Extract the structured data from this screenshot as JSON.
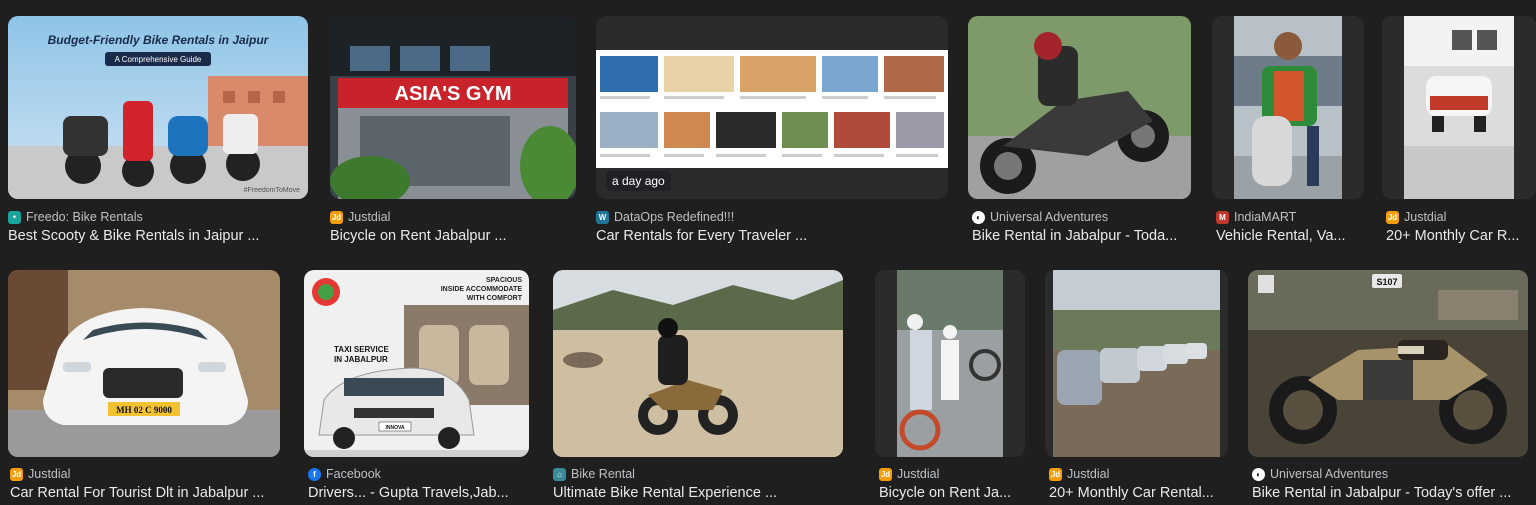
{
  "results": [
    {
      "source": "Freedo: Bike Rentals",
      "source_icon": "freedo-favicon",
      "title": "Best Scooty & Bike Rentals in Jaipur ...",
      "image_text": {
        "headline": "Budget-Friendly Bike Rentals in Jaipur",
        "subhead": "A Comprehensive Guide",
        "tag": "#FreedomToMove"
      }
    },
    {
      "source": "Justdial",
      "source_icon": "justdial-favicon",
      "title": "Bicycle on Rent Jabalpur ...",
      "image_text": {
        "sign": "ASIA'S GYM"
      }
    },
    {
      "source": "DataOps Redefined!!!",
      "source_icon": "wordpress-favicon",
      "title": "Car Rentals for Every Traveler ...",
      "badge": "a day ago"
    },
    {
      "source": "Universal Adventures",
      "source_icon": "universal-adventures-favicon",
      "title": "Bike Rental in Jabalpur - Toda..."
    },
    {
      "source": "IndiaMART",
      "source_icon": "indiamart-favicon",
      "title": "Vehicle Rental, Va..."
    },
    {
      "source": "Justdial",
      "source_icon": "justdial-favicon",
      "title": "20+ Monthly Car R..."
    },
    {
      "source": "Justdial",
      "source_icon": "justdial-favicon",
      "title": "Car Rental For Tourist Dlt in Jabalpur ...",
      "image_text": {
        "plate": "MH 02 C 9000"
      }
    },
    {
      "source": "Facebook",
      "source_icon": "facebook-favicon",
      "title": "Drivers... - Gupta Travels,Jab...",
      "image_text": {
        "line1": "SPACIOUS",
        "line2": "INSIDE ACCOMMODATE",
        "line3": "WITH COMFORT",
        "service1": "TAXI SERVICE",
        "service2": "IN JABALPUR",
        "plate": "INNOVA"
      }
    },
    {
      "source": "Bike Rental",
      "source_icon": "bike-rental-favicon",
      "title": "Ultimate Bike Rental Experience ..."
    },
    {
      "source": "Justdial",
      "source_icon": "justdial-favicon",
      "title": "Bicycle on Rent Ja..."
    },
    {
      "source": "Justdial",
      "source_icon": "justdial-favicon",
      "title": "20+ Monthly Car Rental..."
    },
    {
      "source": "Universal Adventures",
      "source_icon": "universal-adventures-favicon",
      "title": "Bike Rental in Jabalpur - Today's offer ...",
      "image_text": {
        "sign": "S107"
      }
    }
  ],
  "colors": {
    "background": "#1f1f1f",
    "source_text": "#bdc1c6",
    "title_text": "#e8eaed",
    "justdial": "#f59e0b",
    "facebook": "#1877f2",
    "indiamart": "#c0392b",
    "wordpress": "#21759b",
    "freedo": "#1aa39a"
  }
}
